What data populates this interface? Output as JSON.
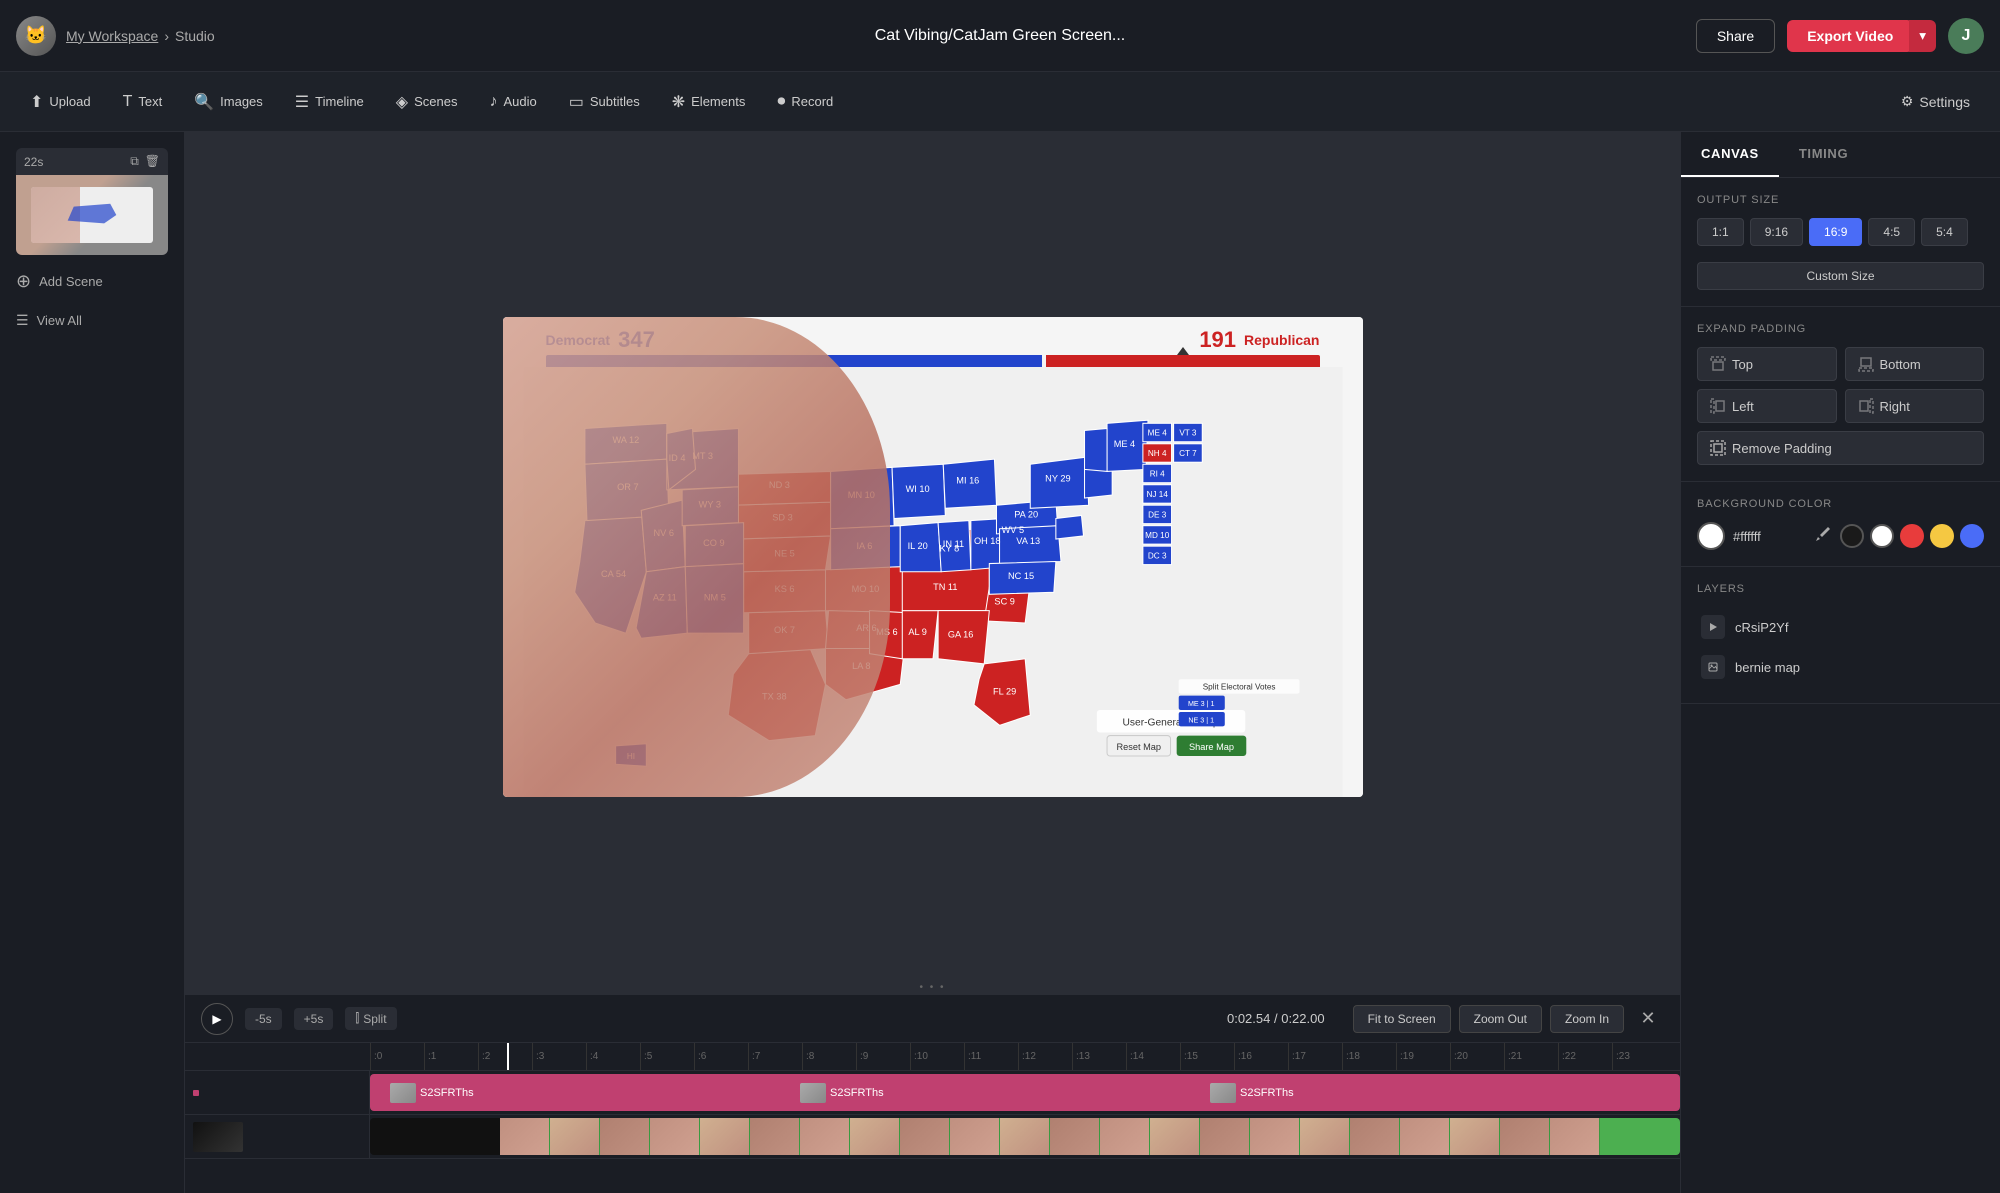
{
  "app": {
    "workspace_label": "My Workspace",
    "breadcrumb_separator": "›",
    "studio_label": "Studio",
    "title": "Cat Vibing/CatJam Green Screen...",
    "share_btn": "Share",
    "export_btn": "Export Video",
    "user_initial": "J"
  },
  "toolbar": {
    "upload": "Upload",
    "text": "Text",
    "images": "Images",
    "timeline": "Timeline",
    "scenes": "Scenes",
    "audio": "Audio",
    "subtitles": "Subtitles",
    "elements": "Elements",
    "record": "Record",
    "settings": "Settings"
  },
  "left_sidebar": {
    "scene_duration": "22s",
    "add_scene": "Add Scene",
    "view_all": "View All"
  },
  "canvas": {
    "electoral": {
      "dem_label": "Democrat",
      "dem_count": "347",
      "rep_count": "191",
      "rep_label": "Republican"
    },
    "map_label": "User-Generated Map",
    "reset_btn": "Reset Map",
    "share_btn": "Share Map"
  },
  "timeline": {
    "play": "▶",
    "skip_back": "-5s",
    "skip_fwd": "+5s",
    "split": "Split",
    "timecode": "0:02.54",
    "duration": "/ 0:22.00",
    "fit_to_screen": "Fit to Screen",
    "zoom_out": "Zoom Out",
    "zoom_in": "Zoom In",
    "close": "✕",
    "ticks": [
      ":0",
      ":1",
      ":2",
      ":3",
      ":4",
      ":5",
      ":6",
      ":7",
      ":8",
      ":9",
      ":10",
      ":11",
      ":12",
      ":13",
      ":14",
      ":15",
      ":16",
      ":17",
      ":18",
      ":19",
      ":20",
      ":21",
      ":22",
      ":23"
    ],
    "track1_segments": [
      "S2SFRThs",
      "S2SFRThs",
      "S2SFRThs"
    ]
  },
  "right_panel": {
    "tab_canvas": "CANVAS",
    "tab_timing": "TIMING",
    "output_size_title": "OUTPUT SIZE",
    "sizes": [
      "1:1",
      "9:16",
      "16:9",
      "4:5",
      "5:4"
    ],
    "active_size": "16:9",
    "custom_size_btn": "Custom Size",
    "expand_padding_title": "EXPAND PADDING",
    "padding_top": "Top",
    "padding_bottom": "Bottom",
    "padding_left": "Left",
    "padding_right": "Right",
    "remove_padding": "Remove Padding",
    "bg_color_title": "BACKGROUND COLOR",
    "bg_color_value": "#ffffff",
    "layers_title": "LAYERS",
    "layer1_name": "cRsiP2Yf",
    "layer2_name": "bernie map"
  }
}
